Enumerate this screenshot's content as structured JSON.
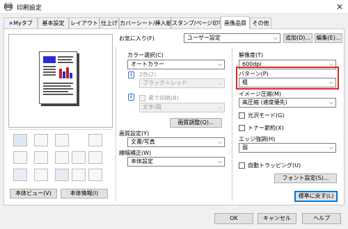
{
  "window": {
    "title": "印刷設定",
    "close_glyph": "✕"
  },
  "tabs": [
    "Myタブ",
    "基本設定",
    "レイアウト",
    "仕上げ",
    "カバーシート/挿入紙",
    "スタンプ/ページ印字",
    "画像品質",
    "その他"
  ],
  "active_tab": "画像品質",
  "favorites": {
    "label": "お気に入り(F)",
    "value": "ユーザー設定",
    "add_label": "追加(D)...",
    "edit_label": "編集(E)..."
  },
  "left_buttons": {
    "view_label": "本体ビュー(V)",
    "info_label": "本体情報(I)"
  },
  "color": {
    "label": "カラー選択(C)",
    "value": "オートカラー",
    "twocolor_label": "2色(2)",
    "twocolor_value": "ブラック＋レッド",
    "mono_checkbox_label": "黒で印刷(B)",
    "mono_value": "文字/図",
    "adjust_button": "画質調整(Q)..."
  },
  "quality": {
    "label": "画質設定(Y)",
    "value": "文書/写真",
    "line_label": "線幅補正(W)",
    "line_value": "本体設定"
  },
  "resolution": {
    "label": "解像度(T)",
    "value": "600dpi"
  },
  "pattern": {
    "label": "パターン(P)",
    "value": "粗"
  },
  "compression": {
    "label": "イメージ圧縮(M)",
    "value": "高圧縮 (速度優先)"
  },
  "checks": {
    "gloss": "光沢モード(G)",
    "toner_save": "トナー節約(X)",
    "auto_trapping": "自動トラッピング(U)"
  },
  "edge": {
    "label": "エッジ強調(H)",
    "value": "弱"
  },
  "font_button": "フォント設定(S)...",
  "reset_button": "標準に戻す(L)",
  "footer": {
    "ok": "OK",
    "cancel": "キャンセル",
    "help": "ヘルプ"
  },
  "colors": {
    "highlight": "#e2231a",
    "accent": "#0078d7"
  }
}
